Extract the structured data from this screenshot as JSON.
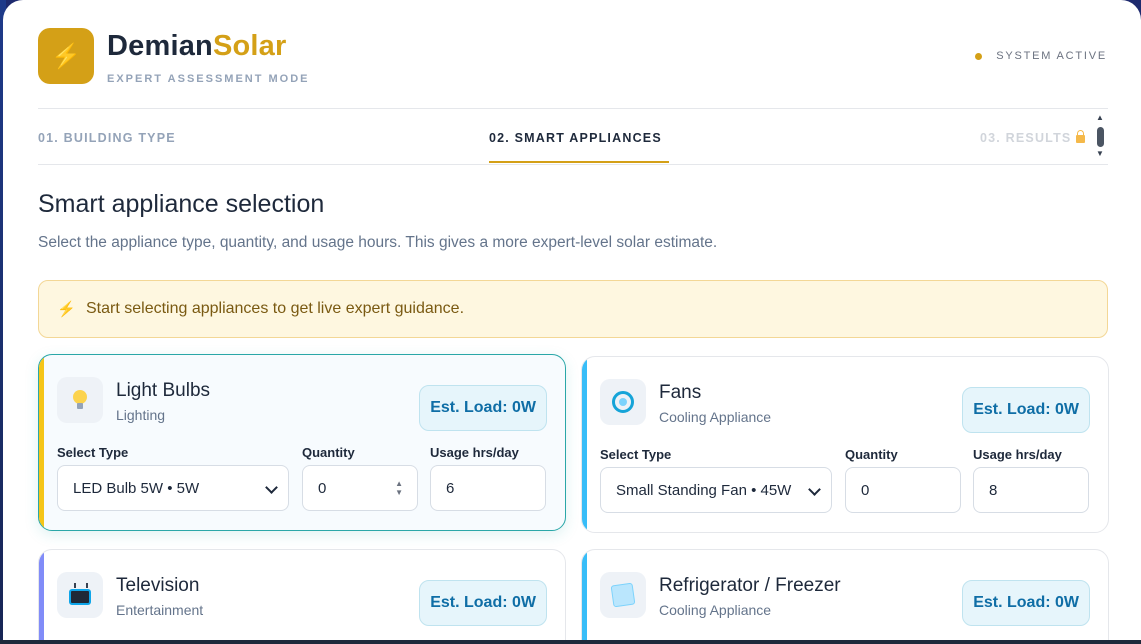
{
  "header": {
    "logo_glyph": "⚡",
    "brand_part1": "Demian",
    "brand_part2": "Solar",
    "subtitle": "EXPERT ASSESSMENT MODE",
    "status": "SYSTEM ACTIVE"
  },
  "tabs": [
    {
      "label": "01. BUILDING TYPE"
    },
    {
      "label": "02. SMART APPLIANCES"
    },
    {
      "label": "03. RESULTS"
    }
  ],
  "section": {
    "title": "Smart appliance selection",
    "description": "Select the appliance type, quantity, and usage hours. This gives a more expert-level solar estimate."
  },
  "tip": {
    "glyph": "⚡",
    "text": "Start selecting appliances to get live expert guidance."
  },
  "field_labels": {
    "type": "Select Type",
    "quantity": "Quantity",
    "usage": "Usage hrs/day"
  },
  "appliances": [
    {
      "name": "Light Bulbs",
      "category": "Lighting",
      "load": "Est. Load: 0W",
      "type": "LED Bulb 5W • 5W",
      "quantity": "0",
      "usage": "6",
      "icon": "lightbulb-icon",
      "accent": "#f5c518"
    },
    {
      "name": "Fans",
      "category": "Cooling Appliance",
      "load": "Est. Load: 0W",
      "type": "Small Standing Fan • 45W",
      "quantity": "0",
      "usage": "8",
      "icon": "fan-icon",
      "accent": "#38bdf8"
    },
    {
      "name": "Television",
      "category": "Entertainment",
      "load": "Est. Load: 0W",
      "icon": "tv-icon",
      "accent": "#818cf8"
    },
    {
      "name": "Refrigerator / Freezer",
      "category": "Cooling Appliance",
      "load": "Est. Load: 0W",
      "icon": "fridge-icon",
      "accent": "#38bdf8"
    }
  ],
  "colors": {
    "brand_gold": "#d4a017",
    "brand_dark": "#1e293b",
    "load_text": "#0f6ea6"
  }
}
